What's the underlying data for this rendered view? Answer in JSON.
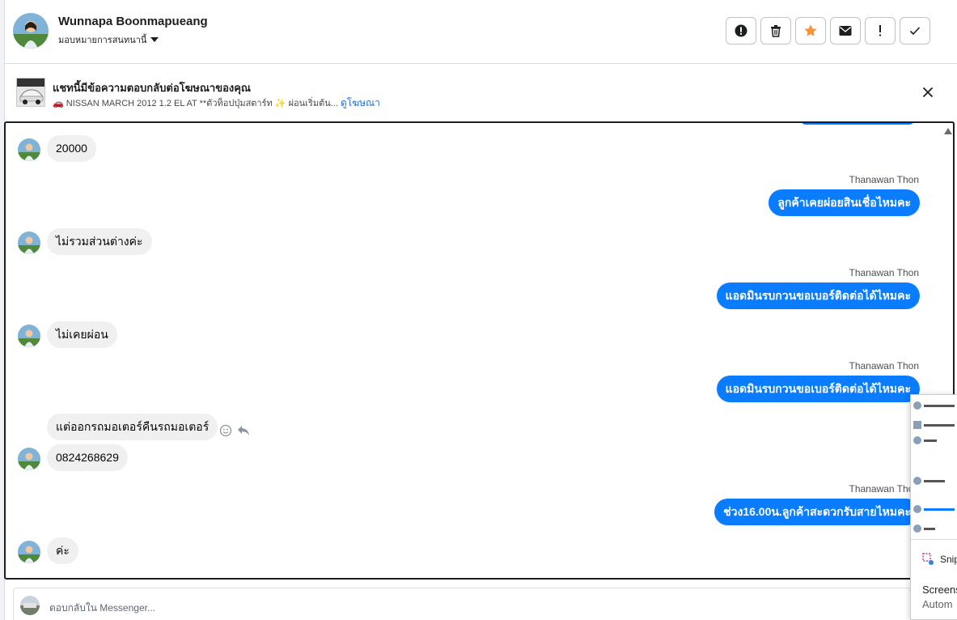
{
  "header": {
    "contact_name": "Wunnapa Boonmapueang",
    "assign_label": "มอบหมายการสนทนานี้",
    "action_icons": [
      "alert-icon",
      "trash-icon",
      "star-icon",
      "mail-icon",
      "exclamation-icon",
      "check-icon"
    ],
    "star_color": "#f7923a"
  },
  "ad_banner": {
    "title": "แชทนี้มีข้อความตอบกลับต่อโฆษณาของคุณ",
    "subtitle": "🚗 NISSAN MARCH 2012 1.2 EL AT **ตัวท็อปปุ่มสตาร์ท ✨ ผ่อนเริ่มต้น...",
    "link": "ดูโฆษณา"
  },
  "messages": [
    {
      "dir": "in",
      "text": "20000"
    },
    {
      "dir": "out",
      "sender": "Thanawan Thon",
      "text": "ลูกค้าเคยผ่อยสินเชื่อไหมคะ"
    },
    {
      "dir": "in",
      "text": "ไม่รวมส่วนต่างค่ะ"
    },
    {
      "dir": "out",
      "sender": "Thanawan Thon",
      "text": "แอดมินรบกวนขอเบอร์ติดต่อได้ไหมคะ"
    },
    {
      "dir": "in",
      "text": "ไม่เคยผ่อน"
    },
    {
      "dir": "out",
      "sender": "Thanawan Thon",
      "text": "แอดมินรบกวนขอเบอร์ติดต่อได้ไหมคะ"
    },
    {
      "dir": "in",
      "text": "แต่ออกรถมอเตอร์คืนรถมอเตอร์"
    },
    {
      "dir": "in",
      "text": "0824268629"
    },
    {
      "dir": "out",
      "sender": "Thanawan Thon",
      "text": "ช่วง16.00น.ลูกค้าสะดวกรับสายไหมคะ"
    },
    {
      "dir": "in",
      "text": "ค่ะ"
    }
  ],
  "accent_color": "#0a7cff",
  "overlay": {
    "snip_label": "Snip",
    "line1": "Screens",
    "line2": "Autom"
  },
  "composer": {
    "placeholder": "ตอบกลับใน Messenger..."
  }
}
